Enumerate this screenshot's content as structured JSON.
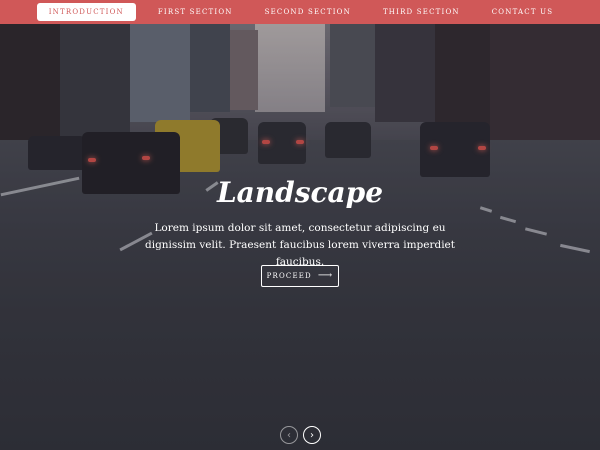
{
  "nav": {
    "items": [
      {
        "label": "INTRODUCTION",
        "active": true
      },
      {
        "label": "FIRST SECTION",
        "active": false
      },
      {
        "label": "SECOND SECTION",
        "active": false
      },
      {
        "label": "THIRD SECTION",
        "active": false
      },
      {
        "label": "CONTACT US",
        "active": false
      }
    ]
  },
  "hero": {
    "title": "Landscape",
    "text": "Lorem ipsum dolor sit amet, consectetur adipiscing eu dignissim velit. Praesent faucibus lorem viverra imperdiet faucibus.",
    "button_label": "PROCEED",
    "button_icon": "arrow-right-icon",
    "background": "city-street-with-cars-photo"
  },
  "pager": {
    "prev_icon": "chevron-left-icon",
    "next_icon": "chevron-right-icon"
  },
  "colors": {
    "nav_bg": "#d05858",
    "text": "#ffffff"
  }
}
